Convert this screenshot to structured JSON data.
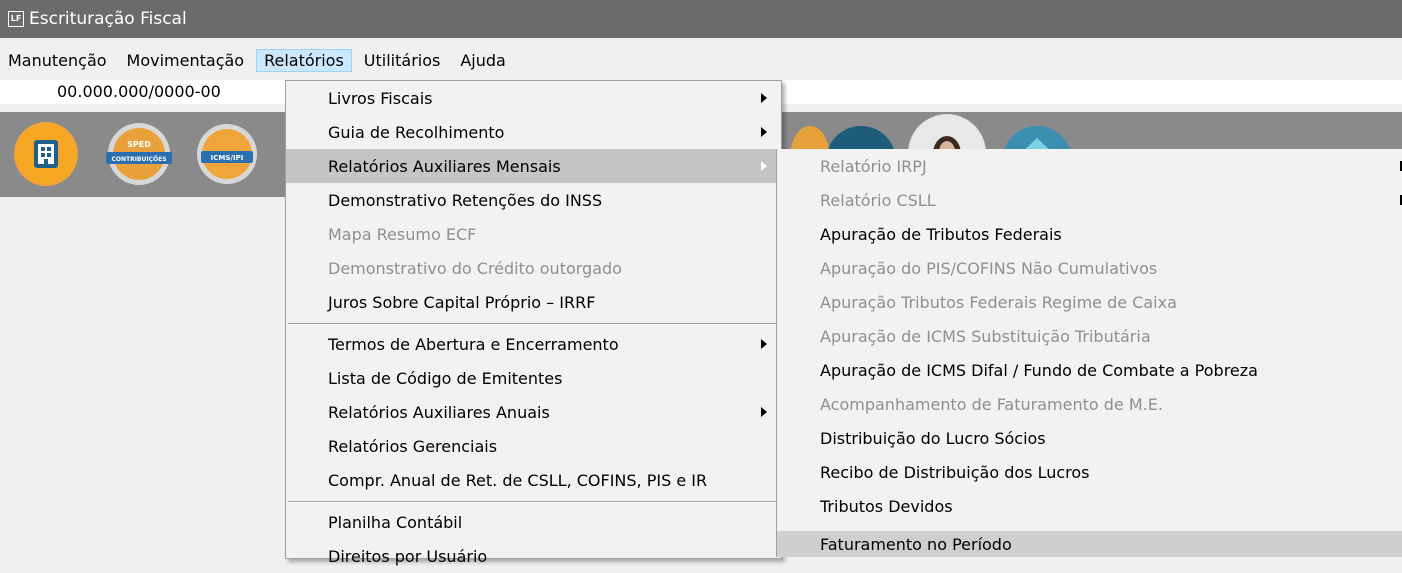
{
  "window": {
    "title": "Escrituração Fiscal",
    "icon_text": "LF"
  },
  "menubar": [
    "Manutenção",
    "Movimentação",
    "Relatórios",
    "Utilitários",
    "Ajuda"
  ],
  "cnpj": "00.000.000/0000-00",
  "toolbar": {
    "icons": [
      {
        "name": "company-icon"
      },
      {
        "name": "sped-contribuicoes-icon",
        "label_top": "SPED",
        "label_bottom": "CONTRIBUIÇÕES"
      },
      {
        "name": "icms-ipi-icon",
        "label": "ICMS/IPI"
      }
    ]
  },
  "relatorios_menu": [
    {
      "label": "Livros Fiscais",
      "submenu": true
    },
    {
      "label": "Guia de Recolhimento",
      "submenu": true
    },
    {
      "label": "Relatórios Auxiliares Mensais",
      "submenu": true,
      "highlighted": true
    },
    {
      "label": "Demonstrativo Retenções do INSS"
    },
    {
      "label": "Mapa Resumo ECF",
      "disabled": true
    },
    {
      "label": "Demonstrativo do Crédito outorgado",
      "disabled": true
    },
    {
      "label": "Juros Sobre Capital Próprio – IRRF"
    },
    {
      "label": "Termos de Abertura e Encerramento",
      "submenu": true
    },
    {
      "label": "Lista de Código de Emitentes"
    },
    {
      "label": "Relatórios Auxiliares Anuais",
      "submenu": true
    },
    {
      "label": "Relatórios Gerenciais"
    },
    {
      "label": "Compr. Anual de Ret. de CSLL, COFINS,  PIS e IR"
    },
    {
      "label": "Planilha Contábil"
    },
    {
      "label": "Direitos por Usuário"
    }
  ],
  "auxiliares_mensais_submenu": [
    {
      "label": "Relatório IRPJ",
      "disabled": true
    },
    {
      "label": "Relatório CSLL",
      "disabled": true
    },
    {
      "label": "Apuração de Tributos Federais"
    },
    {
      "label": "Apuração do PIS/COFINS Não Cumulativos",
      "disabled": true
    },
    {
      "label": "Apuração Tributos Federais Regime de Caixa",
      "disabled": true
    },
    {
      "label": "Apuração de ICMS Substituição Tributária",
      "disabled": true
    },
    {
      "label": "Apuração de ICMS Difal / Fundo de Combate a Pobreza"
    },
    {
      "label": "Acompanhamento de Faturamento de M.E.",
      "disabled": true
    },
    {
      "label": "Distribuição do Lucro Sócios"
    },
    {
      "label": "Recibo de Distribuição dos Lucros"
    },
    {
      "label": "Tributos Devidos"
    },
    {
      "label": "Faturamento no Período",
      "highlighted": true
    }
  ],
  "colors": {
    "titlebar": "#6b6b6b",
    "toolbar": "#8a8a8a",
    "highlight": "#c5c5c5",
    "disabled_text": "#8f8f8f"
  }
}
